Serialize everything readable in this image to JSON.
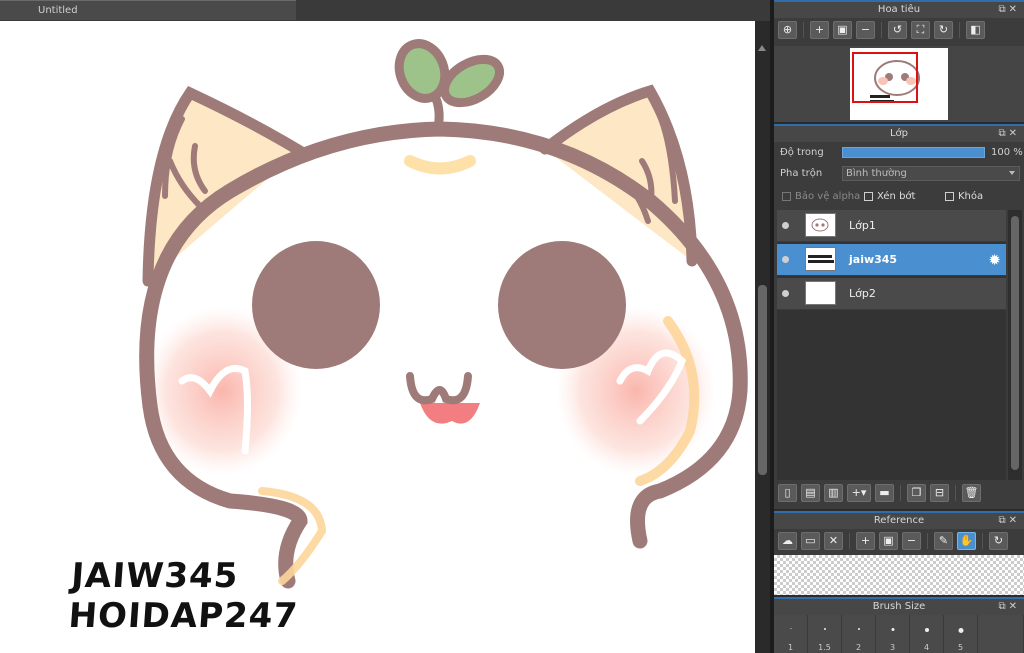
{
  "document": {
    "tab_title": "Untitled"
  },
  "canvas": {
    "watermark_line1": "JAIW345",
    "watermark_line2": "HOIDAP247"
  },
  "navigator": {
    "title": "Hoa tiêu",
    "tool_icons": [
      "zoom-actual-icon",
      "zoom-in-icon",
      "fit-icon",
      "zoom-out-icon",
      "rotate-left-icon",
      "fullscreen-icon",
      "rotate-right-icon",
      "flip-icon"
    ]
  },
  "layers": {
    "title": "Lớp",
    "opacity_label": "Độ trong",
    "opacity_value": "100 %",
    "opacity_fraction": 1.0,
    "blend_label": "Pha trộn",
    "blend_value": "Bình thường",
    "protect_alpha": "Bảo vệ alpha",
    "clipping": "Xén bớt",
    "lock": "Khóa",
    "items": [
      {
        "name": "Lớp1",
        "selected": false
      },
      {
        "name": "jaiw345",
        "selected": true
      },
      {
        "name": "Lớp2",
        "selected": false
      }
    ]
  },
  "reference": {
    "title": "Reference"
  },
  "brush_size": {
    "title": "Brush Size",
    "sizes": [
      "1",
      "1.5",
      "2",
      "3",
      "4",
      "5",
      ""
    ]
  },
  "colors": {
    "accent": "#4a90d0",
    "panel_bg": "#3c3c3c",
    "cat_outline": "#9e7b78",
    "ear_fill": "#fde7c4",
    "leaf": "#9dc38a",
    "cheek": "#f9a99e",
    "mouth": "#f27e82"
  }
}
